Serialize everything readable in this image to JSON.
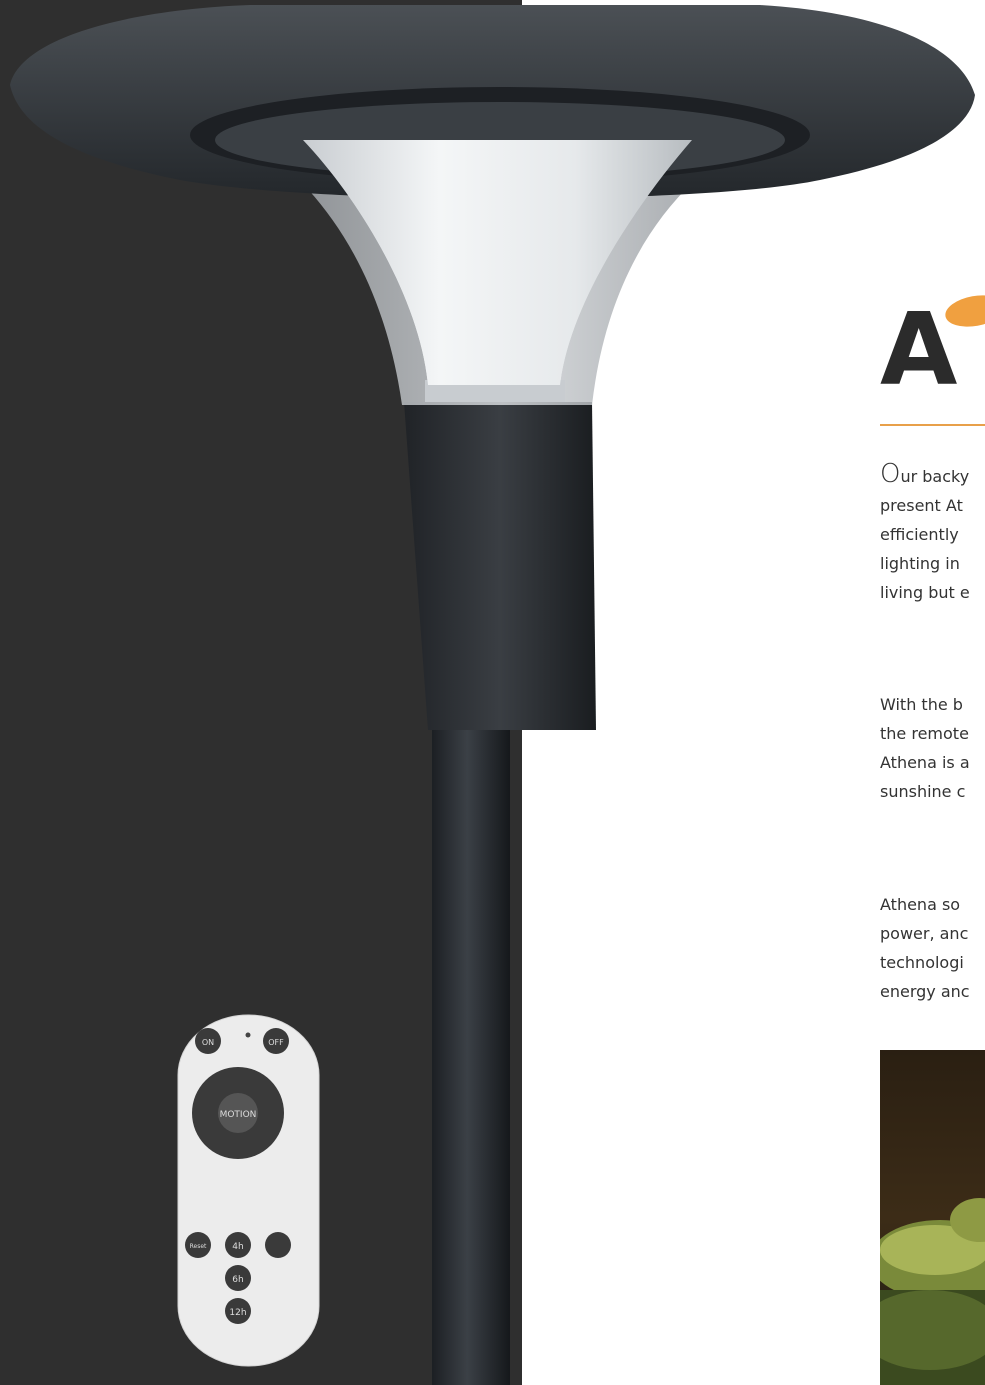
{
  "title": "A",
  "paragraph1": {
    "dropcap": "O",
    "line1": "ur backy",
    "line2": "present At",
    "line3": "efficiently",
    "line4": "lighting in",
    "line5": "living but e"
  },
  "paragraph2": {
    "line1": "With the b",
    "line2": "the remote",
    "line3": "Athena is a",
    "line4": "sunshine c"
  },
  "paragraph3": {
    "line1": "Athena so",
    "line2": "power, anc",
    "line3": "technologi",
    "line4": "energy anc"
  },
  "remote": {
    "on_label": "ON",
    "off_label": "OFF",
    "mode_label": "MOTION",
    "hour4_label": "4h",
    "hour6_label": "6h",
    "hour12_label": "12h",
    "reset_label": "Reset"
  },
  "colors": {
    "dark_panel": "#2f2f2f",
    "accent": "#e8a04a"
  }
}
